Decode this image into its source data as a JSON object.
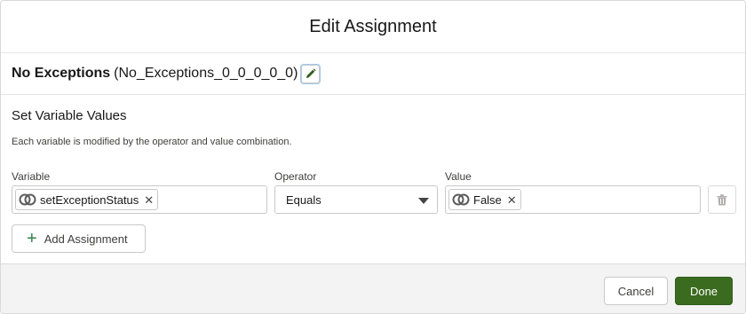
{
  "modal": {
    "title": "Edit Assignment"
  },
  "element": {
    "label": "No Exceptions",
    "api_name": "(No_Exceptions_0_0_0_0_0)",
    "edit_icon": "pencil-icon"
  },
  "section": {
    "title": "Set Variable Values",
    "description": "Each variable is modified by the operator and value combination."
  },
  "columns": {
    "variable": "Variable",
    "operator": "Operator",
    "value": "Value"
  },
  "assignment": {
    "variable": "setExceptionStatus",
    "operator": "Equals",
    "value": "False",
    "resource_icon": "variable-resource-icon",
    "delete_icon": "trash-icon"
  },
  "actions": {
    "add_assignment": "Add Assignment",
    "cancel": "Cancel",
    "done": "Done"
  },
  "colors": {
    "brand_button": "#3b6b1f",
    "add_plus": "#2e844a",
    "footer_bg": "#f3f3f3"
  }
}
